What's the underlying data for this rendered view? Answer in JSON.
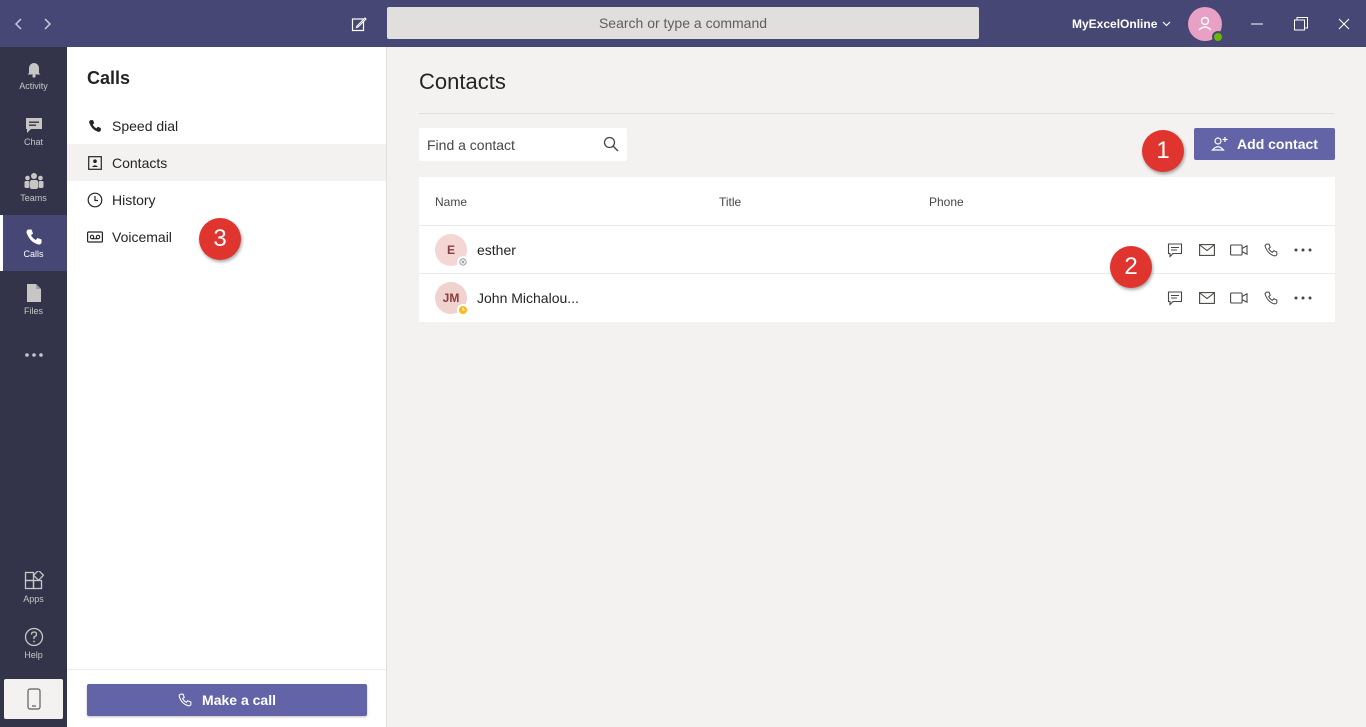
{
  "titlebar": {
    "search_placeholder": "Search or type a command",
    "org_name": "MyExcelOnline"
  },
  "rail": {
    "items": [
      {
        "label": "Activity",
        "icon": "bell-icon"
      },
      {
        "label": "Chat",
        "icon": "chat-icon"
      },
      {
        "label": "Teams",
        "icon": "teams-icon"
      },
      {
        "label": "Calls",
        "icon": "phone-icon",
        "active": true
      },
      {
        "label": "Files",
        "icon": "file-icon"
      },
      {
        "label": "Apps",
        "icon": "apps-icon"
      },
      {
        "label": "Help",
        "icon": "help-icon"
      }
    ]
  },
  "panel": {
    "title": "Calls",
    "items": [
      {
        "label": "Speed dial",
        "icon": "phone-icon"
      },
      {
        "label": "Contacts",
        "icon": "contact-card-icon",
        "active": true
      },
      {
        "label": "History",
        "icon": "clock-icon"
      },
      {
        "label": "Voicemail",
        "icon": "voicemail-icon"
      }
    ],
    "make_call_label": "Make a call"
  },
  "main": {
    "title": "Contacts",
    "find_placeholder": "Find a contact",
    "add_contact_label": "Add contact",
    "columns": [
      "Name",
      "Title",
      "Phone"
    ],
    "contacts": [
      {
        "initials": "E",
        "name": "esther",
        "presence": "offline"
      },
      {
        "initials": "JM",
        "name": "John Michalou...",
        "presence": "away"
      }
    ]
  },
  "callouts": [
    "1",
    "2",
    "3"
  ],
  "colors": {
    "titlebar": "#464775",
    "rail": "#33344a",
    "accent": "#6264a7",
    "callout": "#e0342f"
  }
}
